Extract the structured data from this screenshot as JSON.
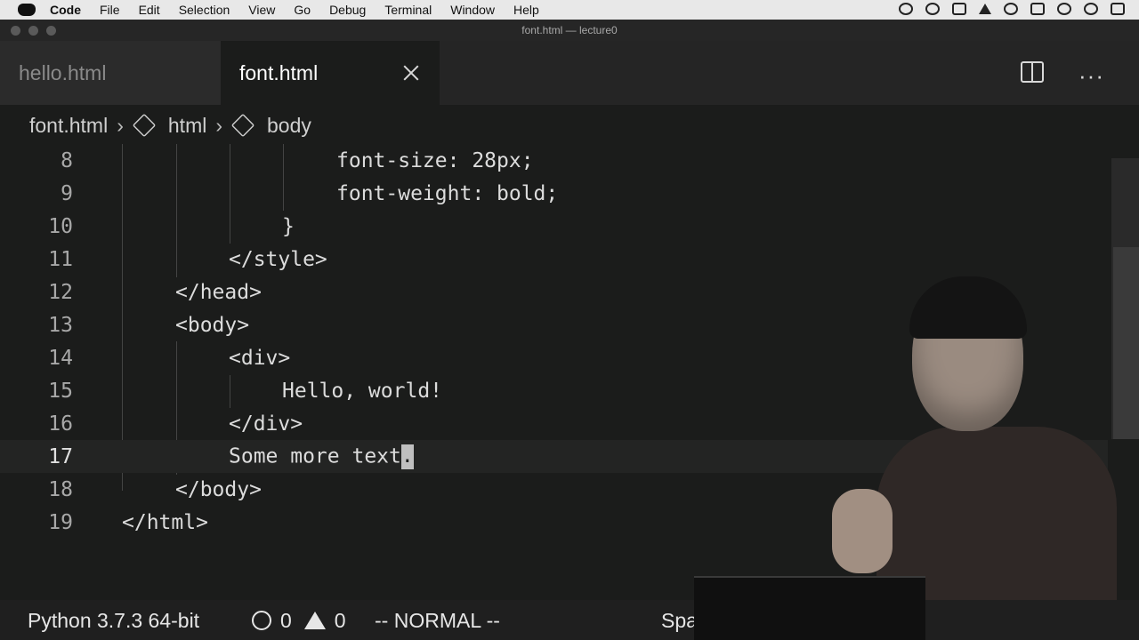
{
  "menubar": {
    "apple": "",
    "items": [
      "Code",
      "File",
      "Edit",
      "Selection",
      "View",
      "Go",
      "Debug",
      "Terminal",
      "Window",
      "Help"
    ]
  },
  "window": {
    "title": "font.html — lecture0"
  },
  "tabs": [
    {
      "label": "hello.html",
      "active": false
    },
    {
      "label": "font.html",
      "active": true
    }
  ],
  "breadcrumb": [
    "font.html",
    "html",
    "body"
  ],
  "editor": {
    "lines": [
      {
        "n": "8",
        "code": "font-size: 28px;"
      },
      {
        "n": "9",
        "code": "font-weight: bold;"
      },
      {
        "n": "10",
        "code": "}"
      },
      {
        "n": "11",
        "code": "</style>"
      },
      {
        "n": "12",
        "code": "</head>"
      },
      {
        "n": "13",
        "code": "<body>"
      },
      {
        "n": "14",
        "code": "<div>"
      },
      {
        "n": "15",
        "code": "Hello, world!"
      },
      {
        "n": "16",
        "code": "</div>"
      },
      {
        "n": "17",
        "code": "Some more text"
      },
      {
        "n": "18",
        "code": "</body>"
      },
      {
        "n": "19",
        "code": "</html>"
      }
    ],
    "cursor_char": ".",
    "current_line": "17"
  },
  "statusbar": {
    "python": "Python 3.7.3 64-bit",
    "errors": "0",
    "warnings": "0",
    "mode": "-- NORMAL --",
    "spaces": "Space"
  }
}
